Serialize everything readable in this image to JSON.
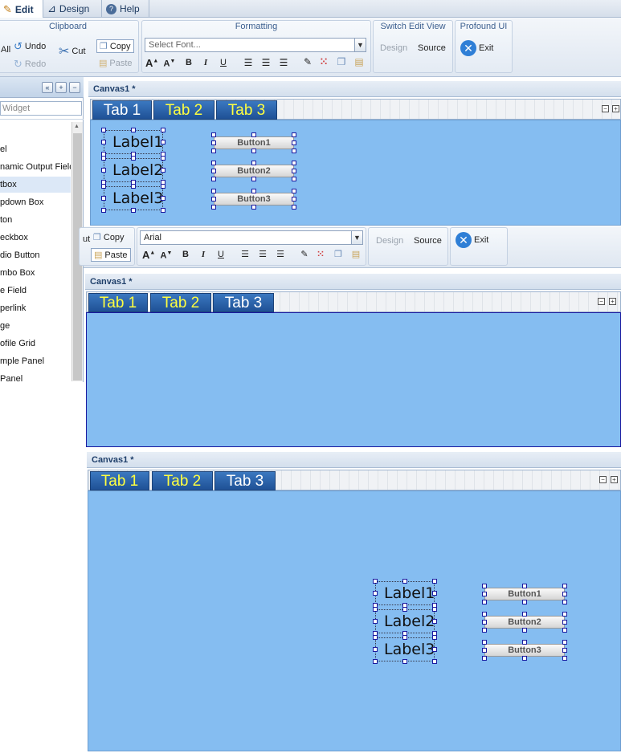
{
  "menu": {
    "tabs": [
      {
        "label": "Edit",
        "icon": "pencil-icon"
      },
      {
        "label": "Design",
        "icon": "design-icon"
      },
      {
        "label": "Help",
        "icon": "help-icon"
      }
    ]
  },
  "ribbon1": {
    "clipboard_title": "Clipboard",
    "all_label": "All",
    "undo_label": "Undo",
    "redo_label": "Redo",
    "cut_label": "Cut",
    "copy_label": "Copy",
    "paste_label": "Paste",
    "formatting_title": "Formatting",
    "font_placeholder": "Select Font...",
    "switch_title": "Switch Edit View",
    "design_label": "Design",
    "source_label": "Source",
    "profound_title": "Profound UI",
    "exit_label": "Exit"
  },
  "ribbon2": {
    "cut_partial": "ut",
    "copy_label": "Copy",
    "paste_label": "Paste",
    "font_value": "Arial",
    "design_label": "Design",
    "source_label": "Source",
    "exit_label": "Exit"
  },
  "format_buttons": {
    "grow": "A",
    "shrink": "A",
    "bold": "B",
    "italic": "I",
    "underline": "U"
  },
  "left_panel": {
    "search_placeholder": "Widget",
    "buttons": [
      "«",
      "+",
      "−"
    ],
    "items": [
      "el",
      "namic Output Field",
      "tbox",
      "pdown Box",
      "ton",
      "eckbox",
      "dio Button",
      "mbo Box",
      "e Field",
      "perlink",
      "ge",
      "ofile Grid",
      "mple Panel",
      "Panel"
    ],
    "selected_index": 2
  },
  "canvases": [
    {
      "title": "Canvas1 *",
      "tabs": [
        "Tab 1",
        "Tab 2",
        "Tab 3"
      ],
      "labels": [
        "Label1",
        "Label2",
        "Label3"
      ],
      "buttons": [
        "Button1",
        "Button2",
        "Button3"
      ]
    },
    {
      "title": "Canvas1 *",
      "tabs": [
        "Tab 1",
        "Tab 2",
        "Tab 3"
      ]
    },
    {
      "title": "Canvas1 *",
      "tabs": [
        "Tab 1",
        "Tab 2",
        "Tab 3"
      ],
      "labels": [
        "Label1",
        "Label2",
        "Label3"
      ],
      "buttons": [
        "Button1",
        "Button2",
        "Button3"
      ]
    }
  ],
  "colors": {
    "canvas_bg": "#85bdf1",
    "tab_bg": "#2a62a8",
    "tab_highlight_text": "#ffff40",
    "ribbon_title": "#3c5f8f"
  }
}
